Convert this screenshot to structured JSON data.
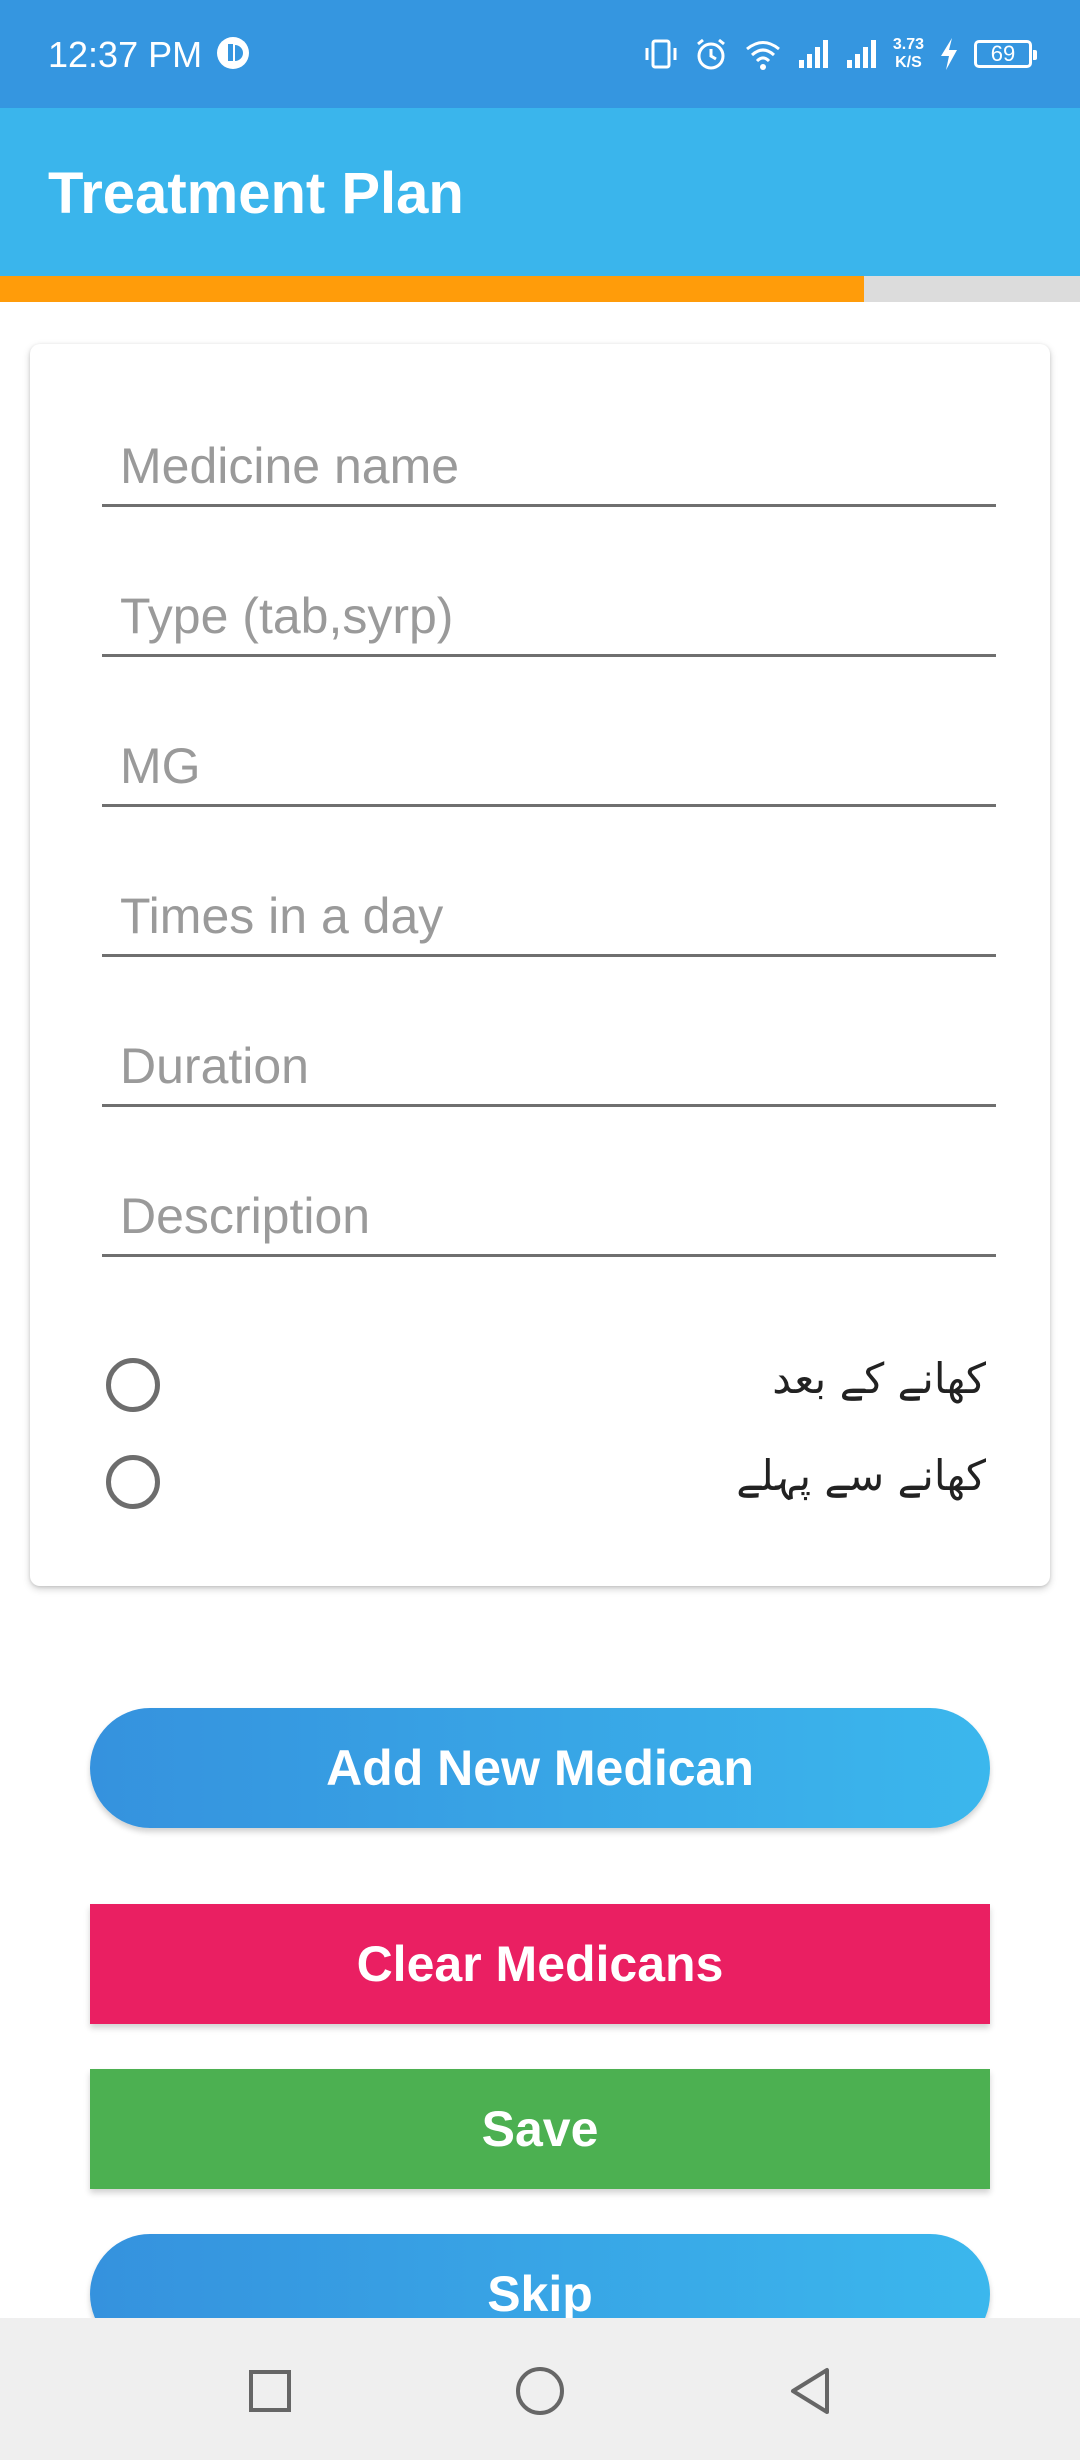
{
  "status_bar": {
    "time": "12:37 PM",
    "speed_value": "3.73",
    "speed_unit": "K/S",
    "battery": "69",
    "icons": [
      "app-notification-icon",
      "vibrate-icon",
      "alarm-icon",
      "wifi-icon",
      "signal-icon",
      "signal-icon",
      "charging-icon",
      "battery-icon"
    ]
  },
  "app_bar": {
    "title": "Treatment Plan"
  },
  "progress": {
    "fraction": 0.8
  },
  "form": {
    "fields": [
      {
        "placeholder": "Medicine name",
        "value": ""
      },
      {
        "placeholder": "Type (tab,syrp)",
        "value": ""
      },
      {
        "placeholder": "MG",
        "value": ""
      },
      {
        "placeholder": "Times in a day",
        "value": ""
      },
      {
        "placeholder": "Duration",
        "value": ""
      },
      {
        "placeholder": "Description",
        "value": ""
      }
    ],
    "radios": [
      {
        "label": "کھانے کے بعد",
        "checked": false
      },
      {
        "label": "کھانے سے پہلے",
        "checked": false
      }
    ]
  },
  "buttons": {
    "add": "Add New Medican",
    "clear": "Clear Medicans",
    "save": "Save",
    "skip": "Skip"
  },
  "nav_bar": {
    "icons": [
      "recent-apps-icon",
      "home-icon",
      "back-icon"
    ]
  },
  "colors": {
    "status_bar": "#3596e0",
    "app_bar": "#3ab5ec",
    "progress": "#ff9c0a",
    "clear_button": "#ea1f62",
    "save_button": "#4cb051"
  }
}
